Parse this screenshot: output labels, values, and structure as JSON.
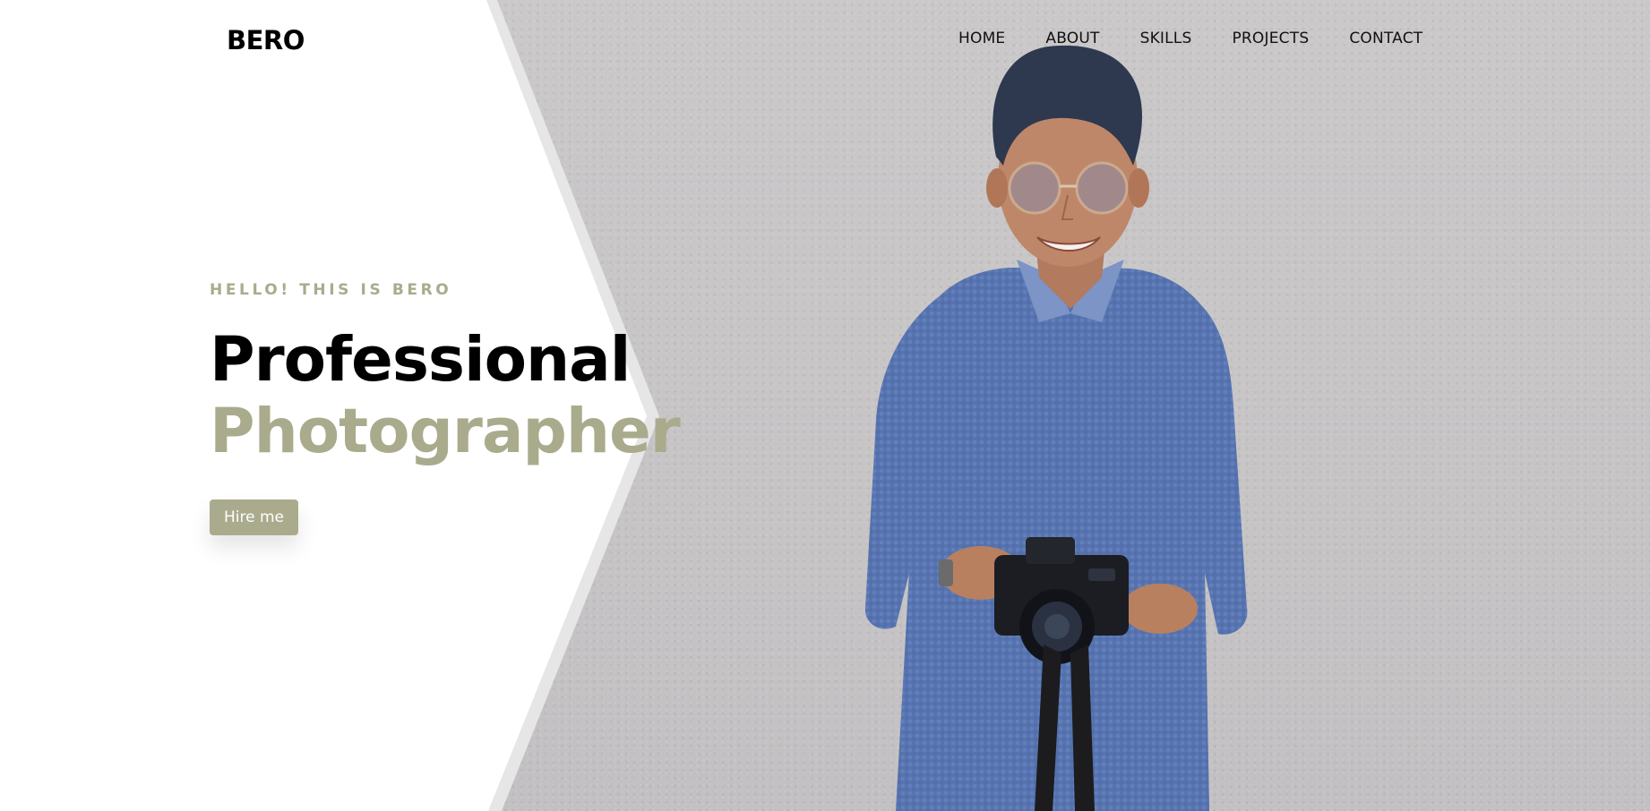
{
  "brand": {
    "logo": "BERO"
  },
  "nav": {
    "items": [
      {
        "label": "HOME"
      },
      {
        "label": "ABOUT"
      },
      {
        "label": "SKILLS"
      },
      {
        "label": "PROJECTS"
      },
      {
        "label": "CONTACT"
      }
    ]
  },
  "hero": {
    "eyebrow": "HELLO! THIS IS BERO",
    "title_line1": "Professional",
    "title_line2": "Photographer",
    "cta_label": "Hire me"
  },
  "colors": {
    "accent": "#a9ab8c",
    "background_wall": "#c9c7c8",
    "panel": "#ffffff",
    "text": "#000000"
  },
  "image": {
    "subject": "photographer-portrait",
    "icon": "person-with-camera-icon"
  }
}
